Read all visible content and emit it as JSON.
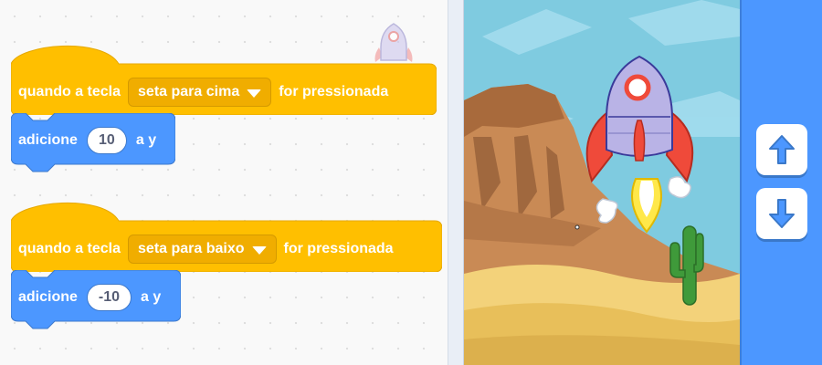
{
  "scripts": [
    {
      "hat": {
        "prefix": "quando a tecla",
        "key": "seta para cima",
        "suffix": "for pressionada"
      },
      "command": {
        "verb": "adicione",
        "value": "10",
        "suffix": "a y"
      }
    },
    {
      "hat": {
        "prefix": "quando a tecla",
        "key": "seta para baixo",
        "suffix": "for pressionada"
      },
      "command": {
        "verb": "adicione",
        "value": "-10",
        "suffix": "a y"
      }
    }
  ],
  "colors": {
    "events_block": "#ffbf00",
    "motion_block": "#4c97ff",
    "button_panel": "#4c97ff",
    "sky": "#7fcbe0",
    "sand": "#f3d27a"
  },
  "icons": {
    "up_button": "arrow-up-icon",
    "down_button": "arrow-down-icon",
    "sprite": "rocket"
  }
}
